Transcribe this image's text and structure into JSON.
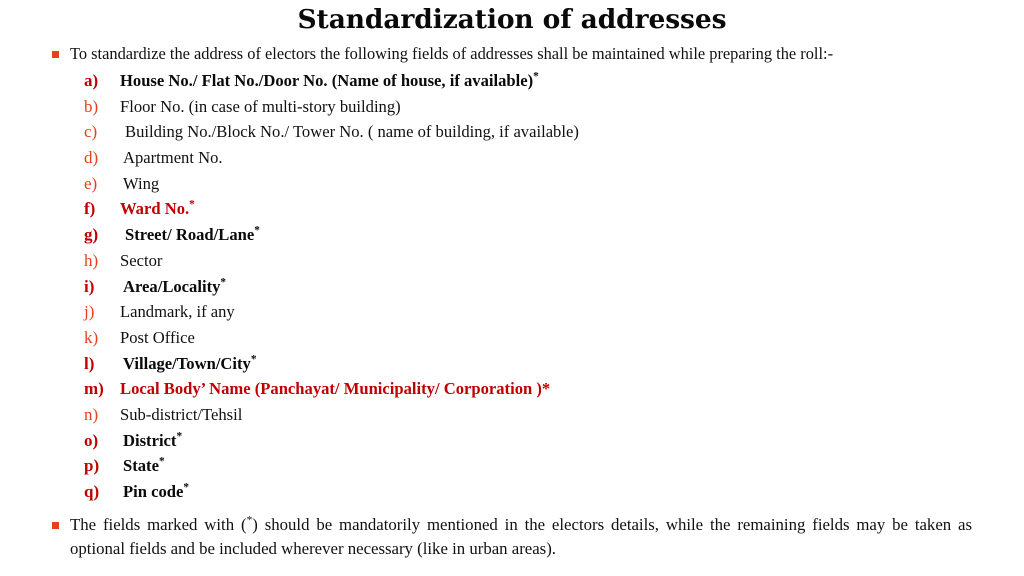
{
  "slide": {
    "title": "Standardization of addresses",
    "accent_bullet_color": "#e8401c",
    "accent_dark_red": "#c00000",
    "body_text_color": "#111111",
    "background_color": "#ffffff",
    "intro": {
      "bullet_icon": "square-bullet-icon",
      "text": "To standardize the address of electors the following fields of addresses shall be maintained while preparing the roll:-"
    },
    "fields": [
      {
        "marker": "a)",
        "text": "House No./ Flat No./Door No. (Name of house, if available)",
        "star": "*",
        "style": "bold"
      },
      {
        "marker": "b)",
        "text": "Floor No. (in case of multi-story building)",
        "star": "",
        "style": "normal"
      },
      {
        "marker": "c)",
        "text": "Building No./Block No./ Tower No. ( name of building, if available)",
        "star": "",
        "style": "normal"
      },
      {
        "marker": "d)",
        "text": "Apartment No.",
        "star": "",
        "style": "normal"
      },
      {
        "marker": "e)",
        "text": "Wing",
        "star": "",
        "style": "normal"
      },
      {
        "marker": "f)",
        "text": "Ward No.",
        "star": "*",
        "style": "red-bold"
      },
      {
        "marker": "g)",
        "text": "Street/ Road/Lane",
        "star": "*",
        "style": "bold"
      },
      {
        "marker": "h)",
        "text": "Sector",
        "star": "",
        "style": "normal"
      },
      {
        "marker": "i)",
        "text": "Area/Locality",
        "star": "*",
        "style": "bold"
      },
      {
        "marker": "j)",
        "text": "Landmark, if any",
        "star": "",
        "style": "normal"
      },
      {
        "marker": "k)",
        "text": "Post Office",
        "star": "",
        "style": "normal"
      },
      {
        "marker": "l)",
        "text": "Village/Town/City",
        "star": "*",
        "style": "bold"
      },
      {
        "marker": "m)",
        "text": "Local Body’ Name (Panchayat/ Municipality/ Corporation )*",
        "star": "",
        "style": "red-bold"
      },
      {
        "marker": "n)",
        "text": "Sub-district/Tehsil",
        "star": "",
        "style": "normal"
      },
      {
        "marker": "o)",
        "text": "District",
        "star": "*",
        "style": "bold"
      },
      {
        "marker": "p)",
        "text": "State",
        "star": "*",
        "style": "bold"
      },
      {
        "marker": "q)",
        "text": "Pin code",
        "star": "*",
        "style": "bold"
      }
    ],
    "closing": {
      "bullet_icon": "square-bullet-icon",
      "text": "The fields marked with (*) should be mandatorily mentioned in the electors details, while the remaining fields may be taken as optional fields and be included wherever necessary (like in urban areas)."
    }
  }
}
